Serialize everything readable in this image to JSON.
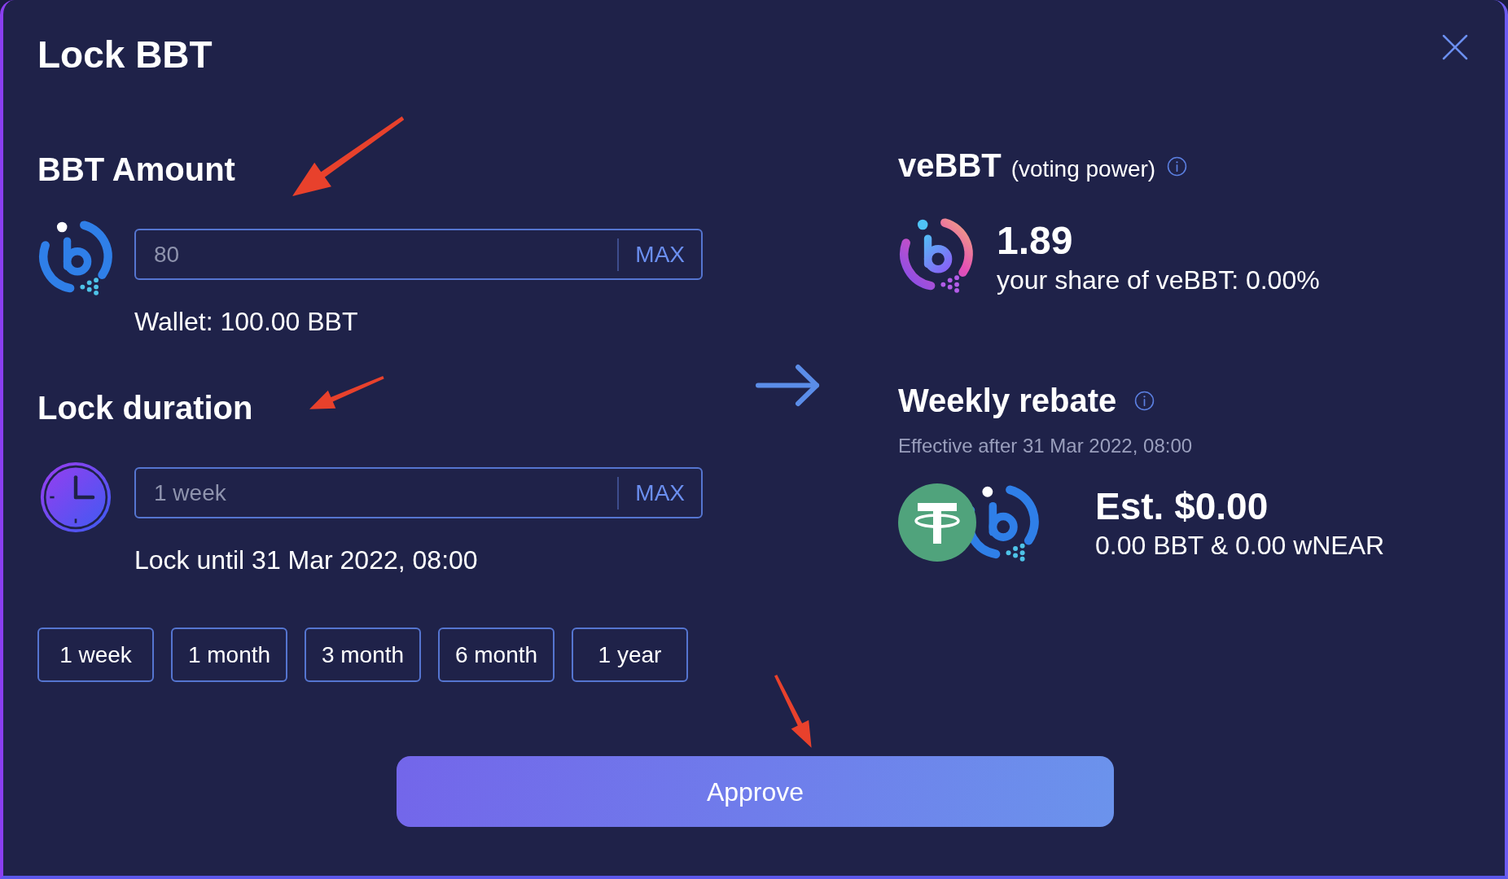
{
  "dialog": {
    "title": "Lock BBT"
  },
  "amount": {
    "heading": "BBT Amount",
    "input": {
      "value": "80",
      "action": "MAX"
    },
    "wallet": "Wallet: 100.00 BBT"
  },
  "duration": {
    "heading": "Lock duration",
    "input": {
      "value": "1 week",
      "action": "MAX"
    },
    "lock_until": "Lock until 31 Mar 2022, 08:00",
    "presets": [
      {
        "label": "1 week",
        "selected": false
      },
      {
        "label": "1 month",
        "selected": false
      },
      {
        "label": "3 month",
        "selected": false
      },
      {
        "label": "6 month",
        "selected": false
      },
      {
        "label": "1 year",
        "selected": false
      }
    ]
  },
  "voting_power": {
    "title": "veBBT",
    "subtitle": "(voting power)",
    "value": "1.89",
    "share": "your share of veBBT: 0.00%"
  },
  "rebate": {
    "title": "Weekly rebate",
    "effective": "Effective after 31 Mar 2022, 08:00",
    "estimate": "Est. $0.00",
    "breakdown": "0.00 BBT & 0.00 wNEAR"
  },
  "approve_button": "Approve"
}
